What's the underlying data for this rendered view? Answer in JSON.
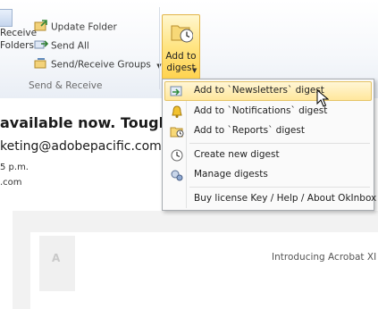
{
  "ribbon": {
    "partial_labels": [
      "Receive",
      "Folders"
    ],
    "update_folder": "Update Folder",
    "send_all": "Send All",
    "send_receive_groups": "Send/Receive Groups",
    "group_label": "Send & Receive",
    "add_digest_label_line1": "Add to",
    "add_digest_label_line2": "digest"
  },
  "email": {
    "subject": "available now. Tough p",
    "sender": "keting@adobepacific.com",
    "time": "5 p.m.",
    "domain_partial": ".com",
    "intro_text": "Introducing Acrobat XI"
  },
  "menu": {
    "items": [
      {
        "label": "Add to `Newsletters` digest",
        "icon": "add-digest-icon"
      },
      {
        "label": "Add to `Notifications` digest",
        "icon": "bell-icon"
      },
      {
        "label": "Add to `Reports` digest",
        "icon": "folder-clock-icon"
      },
      {
        "label": "Create new digest",
        "icon": "clock-icon"
      },
      {
        "label": "Manage digests",
        "icon": "settings-icon"
      },
      {
        "label": "Buy license Key / Help / About OkInbox",
        "icon": ""
      }
    ]
  },
  "colors": {
    "highlight": "#ffe79c",
    "ribbon_button_active": "#ffd34f",
    "menu_border": "#a7abb0"
  }
}
